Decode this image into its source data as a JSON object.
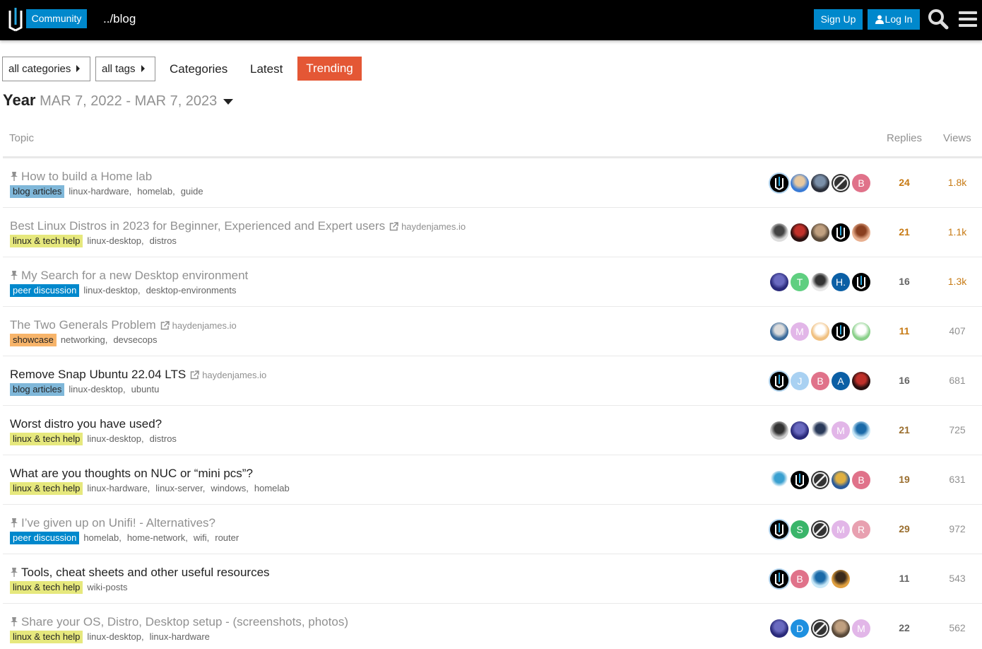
{
  "header": {
    "community_label": "Community",
    "blog_label": "../blog",
    "signup_label": "Sign Up",
    "login_label": "Log In",
    "icons": [
      "site-logo",
      "search-icon",
      "hamburger-menu-icon",
      "user-icon"
    ]
  },
  "nav": {
    "categories_dropdown": "all categories",
    "tags_dropdown": "all tags",
    "links": [
      "Categories",
      "Latest"
    ],
    "active": "Trending",
    "active_color": "#e45735"
  },
  "period": {
    "label": "Year",
    "range": "MAR 7, 2022 - MAR 7, 2023"
  },
  "columns": {
    "topic": "Topic",
    "replies": "Replies",
    "views": "Views"
  },
  "colors": {
    "brand": "#0088cc",
    "blog_articles": "#7fb7d9",
    "linux_tech_help": "#e6e87d",
    "peer_discussion": "#0088cc",
    "showcase": "#f7b46a",
    "replies_hot": "#c77a14",
    "replies_mid": "#9a6e2e",
    "replies_cold": "#646464",
    "views_hot": "#c77a14",
    "views_cold": "#919191"
  },
  "topics": [
    {
      "title": "How to build a Home lab",
      "pinned": true,
      "visited": true,
      "domain": "",
      "category": "blog articles",
      "category_key": "blog_articles",
      "tags": [
        "linux-hardware",
        "homelab",
        "guide"
      ],
      "replies": "24",
      "views": "1.8k",
      "replies_heat": "hot",
      "views_heat": "hot",
      "avatars": [
        {
          "kind": "logo"
        },
        {
          "kind": "img",
          "c1": "#3a7bd5",
          "c2": "#e6c8a0"
        },
        {
          "kind": "img",
          "c1": "#2b2f3a",
          "c2": "#7a8fa8"
        },
        {
          "kind": "slash"
        },
        {
          "kind": "letter",
          "letter": "B",
          "color": "#e0728a"
        }
      ]
    },
    {
      "title": "Best Linux Distros in 2023 for Beginner, Experienced and Expert users",
      "pinned": false,
      "visited": true,
      "domain": "haydenjames.io",
      "category": "linux & tech help",
      "category_key": "linux_tech_help",
      "tags": [
        "linux-desktop",
        "distros"
      ],
      "replies": "21",
      "views": "1.1k",
      "replies_heat": "hot",
      "views_heat": "hot",
      "avatars": [
        {
          "kind": "img",
          "c1": "#ddd",
          "c2": "#444"
        },
        {
          "kind": "img",
          "c1": "#2a1010",
          "c2": "#c0302a"
        },
        {
          "kind": "img",
          "c1": "#5a4a3a",
          "c2": "#c0a080"
        },
        {
          "kind": "logo"
        },
        {
          "kind": "img",
          "c1": "#e8b090",
          "c2": "#8a4020"
        }
      ]
    },
    {
      "title": "My Search for a new Desktop environment",
      "pinned": true,
      "visited": true,
      "domain": "",
      "category": "peer discussion",
      "category_key": "peer_discussion",
      "tags": [
        "linux-desktop",
        "desktop-environments"
      ],
      "replies": "16",
      "views": "1.3k",
      "replies_heat": "cold",
      "views_heat": "hot",
      "avatars": [
        {
          "kind": "img",
          "c1": "#2a2a7a",
          "c2": "#6a6ac0"
        },
        {
          "kind": "letter",
          "letter": "T",
          "color": "#5fcf80"
        },
        {
          "kind": "img",
          "c1": "#e8e8e8",
          "c2": "#333"
        },
        {
          "kind": "letter",
          "letter": "H.",
          "color": "#0b5fa5"
        },
        {
          "kind": "logo"
        }
      ]
    },
    {
      "title": "The Two Generals Problem",
      "pinned": false,
      "visited": true,
      "domain": "haydenjames.io",
      "category": "showcase",
      "category_key": "showcase",
      "tags": [
        "networking",
        "devsecops"
      ],
      "replies": "11",
      "views": "407",
      "replies_heat": "hot",
      "views_heat": "cold",
      "avatars": [
        {
          "kind": "img",
          "c1": "#3a6a9a",
          "c2": "#dcdcdc"
        },
        {
          "kind": "letter",
          "letter": "M",
          "color": "#e2b6e8"
        },
        {
          "kind": "img",
          "c1": "#f0c080",
          "c2": "#fff"
        },
        {
          "kind": "logo"
        },
        {
          "kind": "img",
          "c1": "#8ad08a",
          "c2": "#fff"
        }
      ]
    },
    {
      "title": "Remove Snap Ubuntu 22.04 LTS",
      "pinned": false,
      "visited": false,
      "domain": "haydenjames.io",
      "category": "blog articles",
      "category_key": "blog_articles",
      "tags": [
        "linux-desktop",
        "ubuntu"
      ],
      "replies": "16",
      "views": "681",
      "replies_heat": "cold",
      "views_heat": "cold",
      "avatars": [
        {
          "kind": "logo"
        },
        {
          "kind": "letter",
          "letter": "J",
          "color": "#a9d1f2"
        },
        {
          "kind": "letter",
          "letter": "B",
          "color": "#e0728a"
        },
        {
          "kind": "letter",
          "letter": "A",
          "color": "#0b5fa5"
        },
        {
          "kind": "img",
          "c1": "#2a1010",
          "c2": "#c0302a"
        }
      ]
    },
    {
      "title": "Worst distro you have used?",
      "pinned": false,
      "visited": false,
      "domain": "",
      "category": "linux & tech help",
      "category_key": "linux_tech_help",
      "tags": [
        "linux-desktop",
        "distros"
      ],
      "replies": "21",
      "views": "725",
      "replies_heat": "mid",
      "views_heat": "cold",
      "avatars": [
        {
          "kind": "img",
          "c1": "#ccc",
          "c2": "#333"
        },
        {
          "kind": "img",
          "c1": "#2a2a7a",
          "c2": "#6a6ac0"
        },
        {
          "kind": "img",
          "c1": "#fff",
          "c2": "#2a3a5a"
        },
        {
          "kind": "letter",
          "letter": "M",
          "color": "#e2b6e8"
        },
        {
          "kind": "img",
          "c1": "#c8e8f8",
          "c2": "#1a6aa8"
        }
      ]
    },
    {
      "title": "What are you thoughts on NUC or “mini pcs”?",
      "pinned": false,
      "visited": false,
      "domain": "",
      "category": "linux & tech help",
      "category_key": "linux_tech_help",
      "tags": [
        "linux-hardware",
        "linux-server",
        "windows",
        "homelab"
      ],
      "replies": "19",
      "views": "631",
      "replies_heat": "mid",
      "views_heat": "cold",
      "avatars": [
        {
          "kind": "img",
          "c1": "#fff",
          "c2": "#3aa0d0"
        },
        {
          "kind": "logo"
        },
        {
          "kind": "slash"
        },
        {
          "kind": "img",
          "c1": "#2a5a9a",
          "c2": "#e0b040"
        },
        {
          "kind": "letter",
          "letter": "B",
          "color": "#e0728a"
        }
      ]
    },
    {
      "title": "I’ve given up on Unifi! - Alternatives?",
      "pinned": true,
      "visited": true,
      "domain": "",
      "category": "peer discussion",
      "category_key": "peer_discussion",
      "tags": [
        "homelab",
        "home-network",
        "wifi",
        "router"
      ],
      "replies": "29",
      "views": "972",
      "replies_heat": "mid",
      "views_heat": "cold",
      "avatars": [
        {
          "kind": "logo"
        },
        {
          "kind": "letter",
          "letter": "S",
          "color": "#3ab56a"
        },
        {
          "kind": "slash"
        },
        {
          "kind": "letter",
          "letter": "M",
          "color": "#e2b6e8"
        },
        {
          "kind": "letter",
          "letter": "R",
          "color": "#e8a0b0"
        }
      ]
    },
    {
      "title": "Tools, cheat sheets and other useful resources",
      "pinned": true,
      "visited": false,
      "domain": "",
      "category": "linux & tech help",
      "category_key": "linux_tech_help",
      "tags": [
        "wiki-posts"
      ],
      "replies": "11",
      "views": "543",
      "replies_heat": "cold",
      "views_heat": "cold",
      "avatars": [
        {
          "kind": "logo"
        },
        {
          "kind": "letter",
          "letter": "B",
          "color": "#e0728a"
        },
        {
          "kind": "img",
          "c1": "#c8e8f8",
          "c2": "#1a6aa8"
        },
        {
          "kind": "img",
          "c1": "#e0a040",
          "c2": "#3a2a1a"
        }
      ]
    },
    {
      "title": "Share your OS, Distro, Desktop setup - (screenshots, photos)",
      "pinned": true,
      "visited": true,
      "domain": "",
      "category": "linux & tech help",
      "category_key": "linux_tech_help",
      "tags": [
        "linux-desktop",
        "linux-hardware"
      ],
      "replies": "22",
      "views": "562",
      "replies_heat": "cold",
      "views_heat": "cold",
      "avatars": [
        {
          "kind": "img",
          "c1": "#2a2a7a",
          "c2": "#6a6ac0"
        },
        {
          "kind": "letter",
          "letter": "D",
          "color": "#1e90e0"
        },
        {
          "kind": "slash"
        },
        {
          "kind": "img",
          "c1": "#5a4a3a",
          "c2": "#c0a080"
        },
        {
          "kind": "letter",
          "letter": "M",
          "color": "#e2b6e8"
        }
      ]
    }
  ]
}
